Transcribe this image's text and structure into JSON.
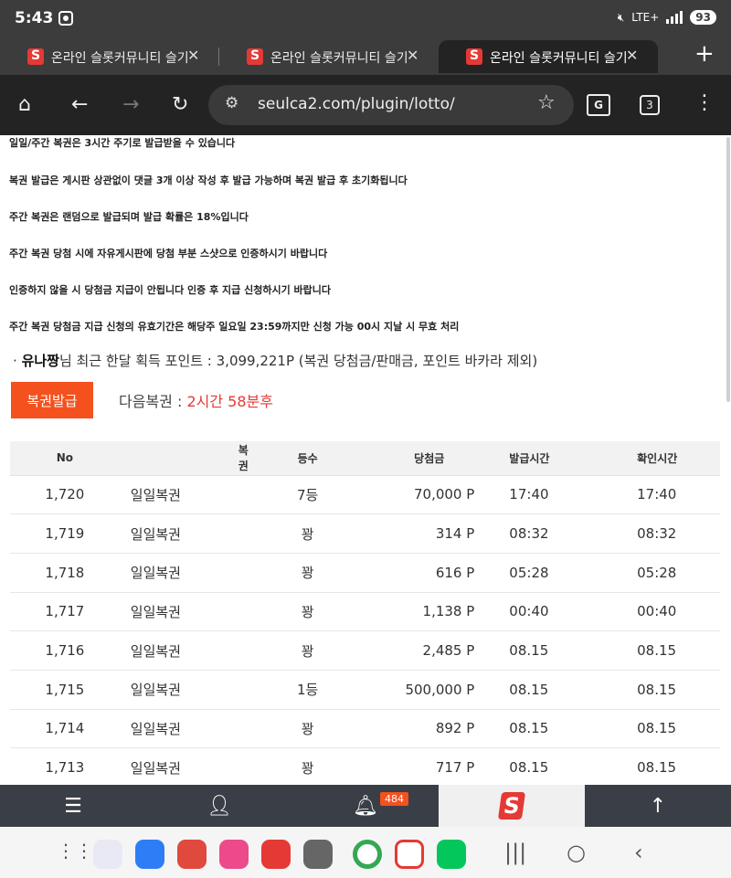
{
  "status": {
    "time": "5:43",
    "network": "LTE+",
    "battery": "93"
  },
  "tabs": [
    {
      "title": "온라인 슬롯커뮤니티 슬기로운"
    },
    {
      "title": "온라인 슬롯커뮤니티 슬기로운"
    },
    {
      "title": "온라인 슬롯커뮤니티 슬기로운"
    }
  ],
  "toolbar": {
    "url": "seulca2.com/plugin/lotto/",
    "tab_count": "3",
    "translate_label": "G"
  },
  "notices": [
    "일일/주간 복권은 3시간 주기로 발급받을 수 있습니다",
    "복권 발급은 게시판 상관없이 댓글 3개 이상 작성 후 발급 가능하며 복권 발급 후 초기화됩니다",
    "주간 복권은 랜덤으로 발급되며 발급 확률은 18%입니다",
    "주간 복권 당첨 시에 자유게시판에 당첨 부분 스샷으로 인증하시기 바랍니다",
    "인증하지 않을 시 당첨금 지급이 안됩니다 인증 후 지급 신청하시기 바랍니다",
    "주간 복권 당첨금 지급 신청의 유효기간은 해당주 일요일 23:59까지만 신청 가능 00시 지날 시 무효 처리"
  ],
  "points": {
    "bullet": "·",
    "user": "유나짱",
    "text": "님 최근 한달 획득 포인트 : 3,099,221P (복권 당첨금/판매금, 포인트 바카라 제외)"
  },
  "issue_button": "복권발급",
  "next_lotto": {
    "label": "다음복권 : ",
    "value": "2시간 58분후"
  },
  "table": {
    "headers": [
      "No",
      "복권",
      "등수",
      "당첨금",
      "발급시간",
      "확인시간"
    ],
    "rows": [
      [
        "1,720",
        "일일복권",
        "7등",
        "70,000 P",
        "17:40",
        "17:40"
      ],
      [
        "1,719",
        "일일복권",
        "꽝",
        "314 P",
        "08:32",
        "08:32"
      ],
      [
        "1,718",
        "일일복권",
        "꽝",
        "616 P",
        "05:28",
        "05:28"
      ],
      [
        "1,717",
        "일일복권",
        "꽝",
        "1,138 P",
        "00:40",
        "00:40"
      ],
      [
        "1,716",
        "일일복권",
        "꽝",
        "2,485 P",
        "08.15",
        "08.15"
      ],
      [
        "1,715",
        "일일복권",
        "1등",
        "500,000 P",
        "08.15",
        "08.15"
      ],
      [
        "1,714",
        "일일복권",
        "꽝",
        "892 P",
        "08.15",
        "08.15"
      ],
      [
        "1,713",
        "일일복권",
        "꽝",
        "717 P",
        "08.15",
        "08.15"
      ]
    ]
  },
  "bottom_nav": {
    "badge": "484",
    "logo_letter": "S"
  },
  "colors": {
    "accent": "#f4511e",
    "next_value": "#e53935",
    "toolbar_bg": "#232323",
    "nav_bg": "#3a3f47"
  }
}
